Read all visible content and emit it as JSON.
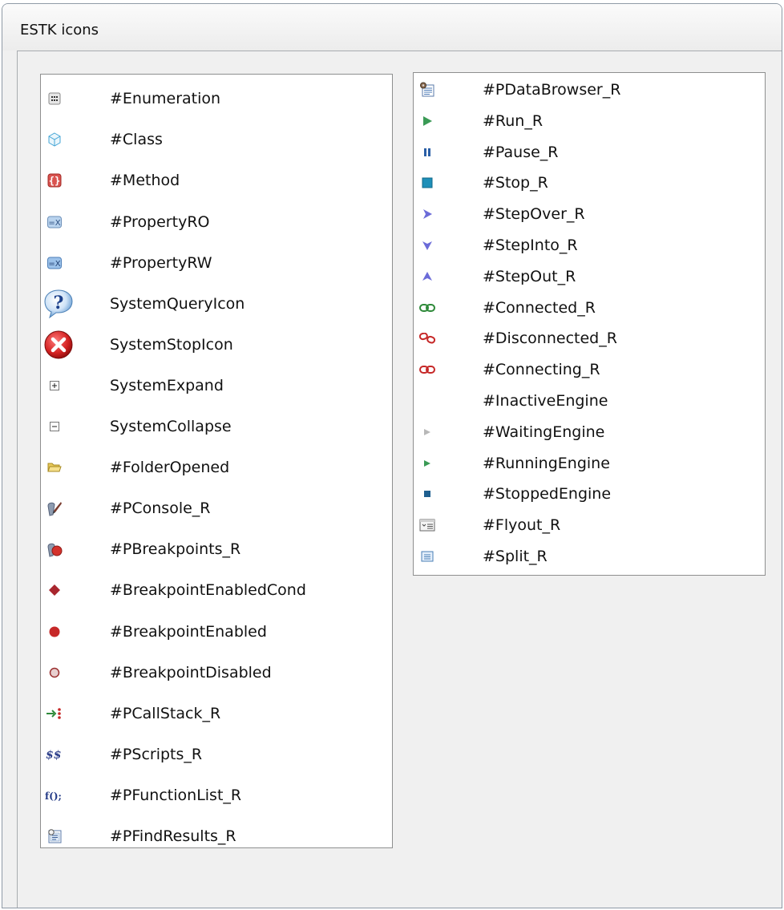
{
  "window": {
    "title": "ESTK icons"
  },
  "left_list": [
    {
      "icon": "enumeration-icon",
      "label": "#Enumeration"
    },
    {
      "icon": "class-icon",
      "label": "#Class"
    },
    {
      "icon": "method-icon",
      "label": "#Method"
    },
    {
      "icon": "property-ro-icon",
      "label": "#PropertyRO"
    },
    {
      "icon": "property-rw-icon",
      "label": "#PropertyRW"
    },
    {
      "icon": "system-query-icon",
      "label": "SystemQueryIcon"
    },
    {
      "icon": "system-stop-icon",
      "label": "SystemStopIcon"
    },
    {
      "icon": "system-expand-icon",
      "label": "SystemExpand"
    },
    {
      "icon": "system-collapse-icon",
      "label": "SystemCollapse"
    },
    {
      "icon": "folder-opened-icon",
      "label": "#FolderOpened"
    },
    {
      "icon": "console-icon",
      "label": "#PConsole_R"
    },
    {
      "icon": "breakpoints-icon",
      "label": "#PBreakpoints_R"
    },
    {
      "icon": "breakpoint-enabled-cond-icon",
      "label": "#BreakpointEnabledCond"
    },
    {
      "icon": "breakpoint-enabled-icon",
      "label": "#BreakpointEnabled"
    },
    {
      "icon": "breakpoint-disabled-icon",
      "label": "#BreakpointDisabled"
    },
    {
      "icon": "call-stack-icon",
      "label": "#PCallStack_R"
    },
    {
      "icon": "scripts-icon",
      "label": "#PScripts_R"
    },
    {
      "icon": "function-list-icon",
      "label": "#PFunctionList_R"
    },
    {
      "icon": "find-results-icon",
      "label": "#PFindResults_R"
    }
  ],
  "right_list": [
    {
      "icon": "data-browser-icon",
      "label": "#PDataBrowser_R"
    },
    {
      "icon": "run-icon",
      "label": "#Run_R"
    },
    {
      "icon": "pause-icon",
      "label": "#Pause_R"
    },
    {
      "icon": "stop-icon",
      "label": "#Stop_R"
    },
    {
      "icon": "step-over-icon",
      "label": "#StepOver_R"
    },
    {
      "icon": "step-into-icon",
      "label": "#StepInto_R"
    },
    {
      "icon": "step-out-icon",
      "label": "#StepOut_R"
    },
    {
      "icon": "connected-icon",
      "label": "#Connected_R"
    },
    {
      "icon": "disconnected-icon",
      "label": "#Disconnected_R"
    },
    {
      "icon": "connecting-icon",
      "label": "#Connecting_R"
    },
    {
      "icon": "inactive-engine-icon",
      "label": "#InactiveEngine"
    },
    {
      "icon": "waiting-engine-icon",
      "label": "#WaitingEngine"
    },
    {
      "icon": "running-engine-icon",
      "label": "#RunningEngine"
    },
    {
      "icon": "stopped-engine-icon",
      "label": "#StoppedEngine"
    },
    {
      "icon": "flyout-icon",
      "label": "#Flyout_R"
    },
    {
      "icon": "split-icon",
      "label": "#Split_R"
    }
  ],
  "colors": {
    "window_bg": "#f0f0f0",
    "panel_bg": "#ffffff",
    "run_green": "#3a9a55",
    "step_purple": "#6b6bd8",
    "stop_teal": "#1e8fb8",
    "breakpoint_red": "#c62828"
  }
}
